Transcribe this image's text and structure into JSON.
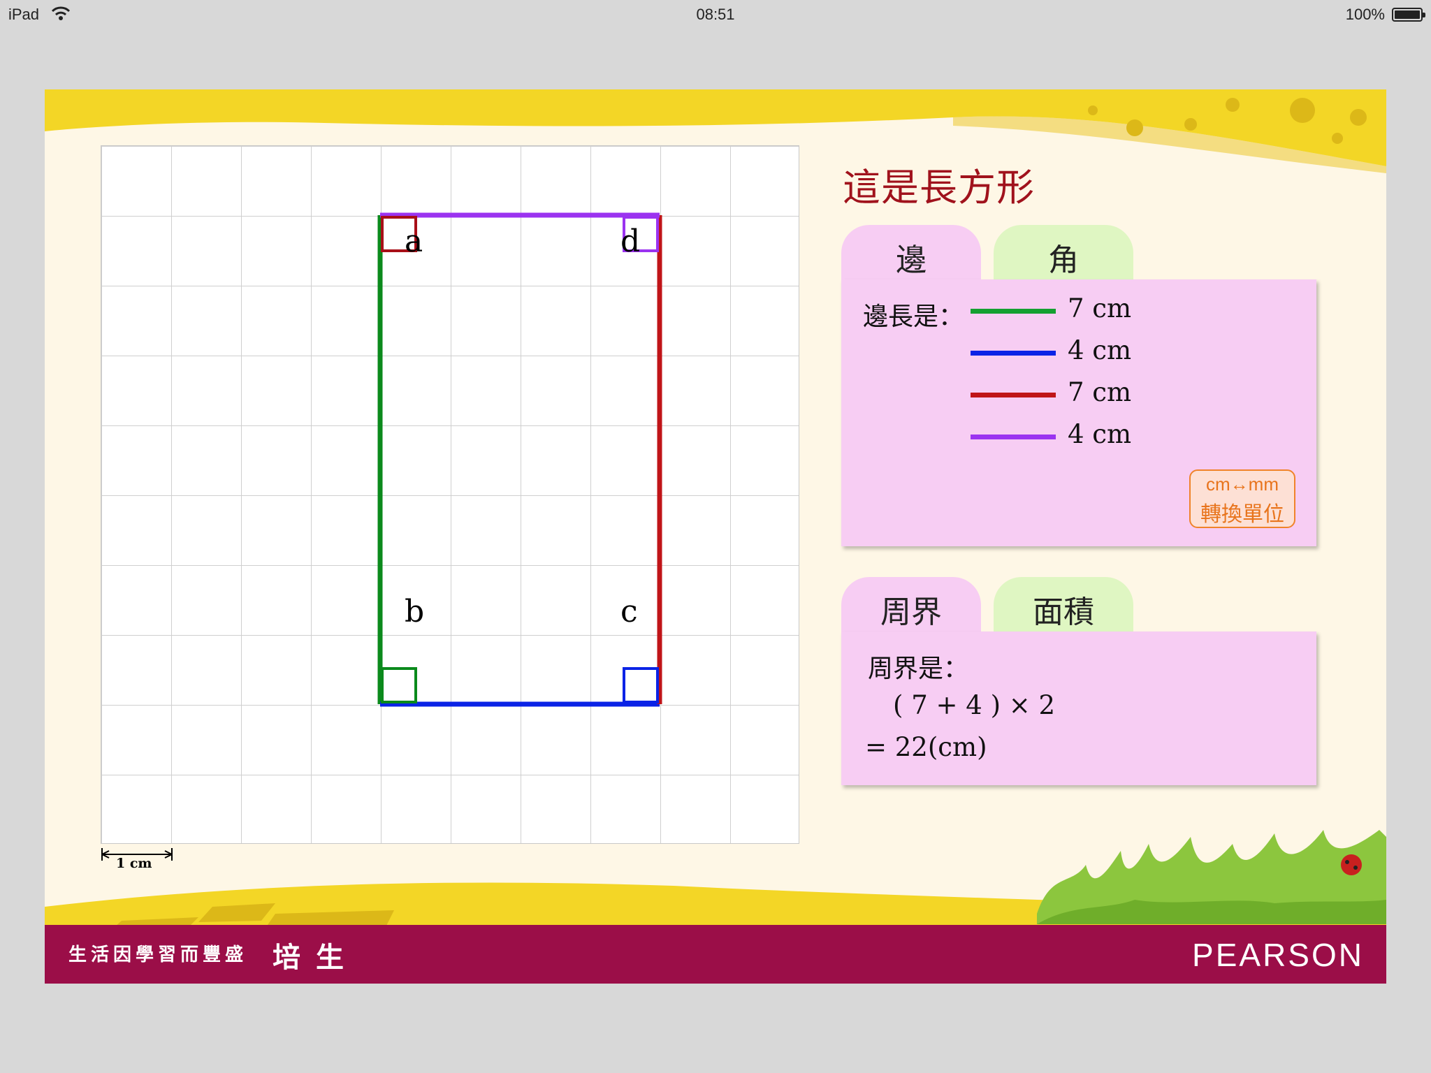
{
  "status_bar": {
    "device": "iPad",
    "time": "08:51",
    "battery": "100%"
  },
  "drawing": {
    "vertices": [
      "a",
      "b",
      "c",
      "d"
    ],
    "scale_label": "1 cm",
    "side_colors": {
      "ab": "#0b8a1c",
      "bc": "#0b23e6",
      "cd": "#c01418",
      "da": "#9b33f0"
    }
  },
  "title": "這是長方形",
  "tabs_top": [
    {
      "label": "邊",
      "active": true
    },
    {
      "label": "角",
      "active": false
    }
  ],
  "sides": {
    "caption": "邊長是：",
    "items": [
      {
        "length": "7 cm",
        "color": "#14a030"
      },
      {
        "length": "4 cm",
        "color": "#0b23e6"
      },
      {
        "length": "7 cm",
        "color": "#c01418"
      },
      {
        "length": "4 cm",
        "color": "#9b33f0"
      }
    ],
    "convert_button": {
      "line1": "cm↔mm",
      "line2": "轉換單位"
    }
  },
  "tabs_bottom": [
    {
      "label": "周界",
      "active": true
    },
    {
      "label": "面積",
      "active": false
    }
  ],
  "perimeter": {
    "caption": "周界是：",
    "expression": "( 7 + 4 ) × 2",
    "result": "= 22(cm)"
  },
  "footer": {
    "slogan": "生活因學習而豐盛",
    "name": "培生",
    "brand": "PEARSON"
  }
}
